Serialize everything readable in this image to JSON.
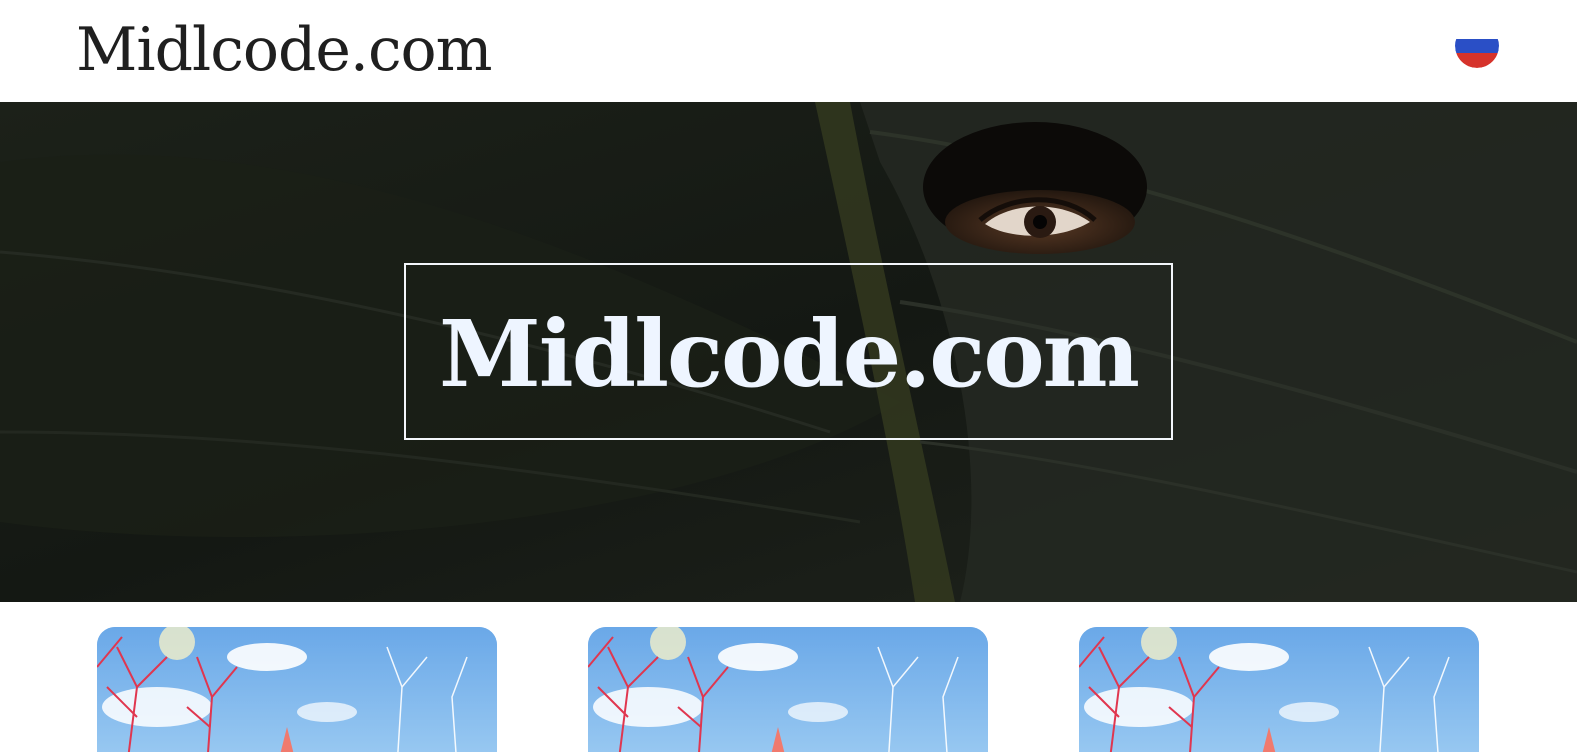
{
  "header": {
    "brand": "Midlcode.com",
    "language_flag": "russia-flag-icon"
  },
  "hero": {
    "title": "Midlcode.com"
  },
  "cards": [
    {
      "image": "red-trees-blue-sky-photo"
    },
    {
      "image": "red-trees-blue-sky-photo"
    },
    {
      "image": "red-trees-blue-sky-photo"
    }
  ],
  "colors": {
    "flag_white": "#ffffff",
    "flag_blue": "#2a4fc6",
    "flag_red": "#d6332b",
    "hero_title": "#eef5ff",
    "hero_bg": "#161a15"
  }
}
